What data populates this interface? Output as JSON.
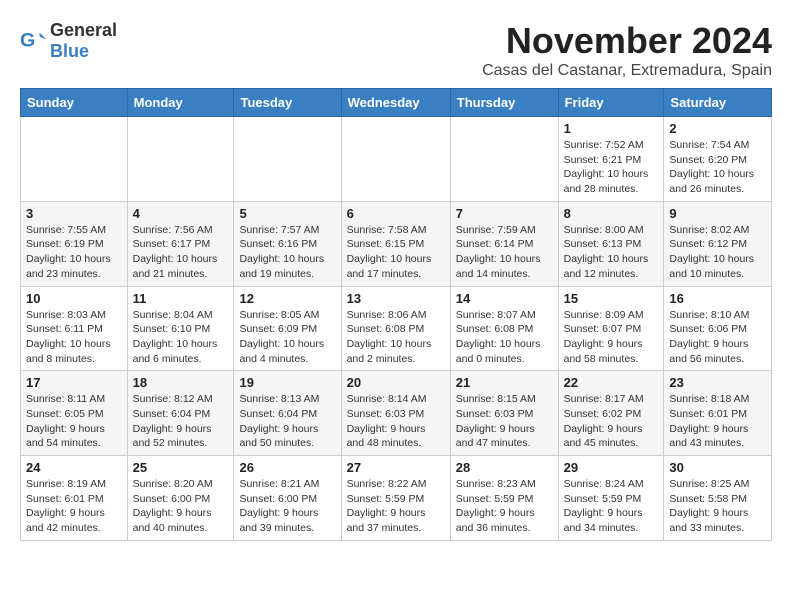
{
  "logo": {
    "general": "General",
    "blue": "Blue"
  },
  "title": "November 2024",
  "subtitle": "Casas del Castanar, Extremadura, Spain",
  "headers": [
    "Sunday",
    "Monday",
    "Tuesday",
    "Wednesday",
    "Thursday",
    "Friday",
    "Saturday"
  ],
  "weeks": [
    [
      {
        "day": "",
        "info": ""
      },
      {
        "day": "",
        "info": ""
      },
      {
        "day": "",
        "info": ""
      },
      {
        "day": "",
        "info": ""
      },
      {
        "day": "",
        "info": ""
      },
      {
        "day": "1",
        "info": "Sunrise: 7:52 AM\nSunset: 6:21 PM\nDaylight: 10 hours and 28 minutes."
      },
      {
        "day": "2",
        "info": "Sunrise: 7:54 AM\nSunset: 6:20 PM\nDaylight: 10 hours and 26 minutes."
      }
    ],
    [
      {
        "day": "3",
        "info": "Sunrise: 7:55 AM\nSunset: 6:19 PM\nDaylight: 10 hours and 23 minutes."
      },
      {
        "day": "4",
        "info": "Sunrise: 7:56 AM\nSunset: 6:17 PM\nDaylight: 10 hours and 21 minutes."
      },
      {
        "day": "5",
        "info": "Sunrise: 7:57 AM\nSunset: 6:16 PM\nDaylight: 10 hours and 19 minutes."
      },
      {
        "day": "6",
        "info": "Sunrise: 7:58 AM\nSunset: 6:15 PM\nDaylight: 10 hours and 17 minutes."
      },
      {
        "day": "7",
        "info": "Sunrise: 7:59 AM\nSunset: 6:14 PM\nDaylight: 10 hours and 14 minutes."
      },
      {
        "day": "8",
        "info": "Sunrise: 8:00 AM\nSunset: 6:13 PM\nDaylight: 10 hours and 12 minutes."
      },
      {
        "day": "9",
        "info": "Sunrise: 8:02 AM\nSunset: 6:12 PM\nDaylight: 10 hours and 10 minutes."
      }
    ],
    [
      {
        "day": "10",
        "info": "Sunrise: 8:03 AM\nSunset: 6:11 PM\nDaylight: 10 hours and 8 minutes."
      },
      {
        "day": "11",
        "info": "Sunrise: 8:04 AM\nSunset: 6:10 PM\nDaylight: 10 hours and 6 minutes."
      },
      {
        "day": "12",
        "info": "Sunrise: 8:05 AM\nSunset: 6:09 PM\nDaylight: 10 hours and 4 minutes."
      },
      {
        "day": "13",
        "info": "Sunrise: 8:06 AM\nSunset: 6:08 PM\nDaylight: 10 hours and 2 minutes."
      },
      {
        "day": "14",
        "info": "Sunrise: 8:07 AM\nSunset: 6:08 PM\nDaylight: 10 hours and 0 minutes."
      },
      {
        "day": "15",
        "info": "Sunrise: 8:09 AM\nSunset: 6:07 PM\nDaylight: 9 hours and 58 minutes."
      },
      {
        "day": "16",
        "info": "Sunrise: 8:10 AM\nSunset: 6:06 PM\nDaylight: 9 hours and 56 minutes."
      }
    ],
    [
      {
        "day": "17",
        "info": "Sunrise: 8:11 AM\nSunset: 6:05 PM\nDaylight: 9 hours and 54 minutes."
      },
      {
        "day": "18",
        "info": "Sunrise: 8:12 AM\nSunset: 6:04 PM\nDaylight: 9 hours and 52 minutes."
      },
      {
        "day": "19",
        "info": "Sunrise: 8:13 AM\nSunset: 6:04 PM\nDaylight: 9 hours and 50 minutes."
      },
      {
        "day": "20",
        "info": "Sunrise: 8:14 AM\nSunset: 6:03 PM\nDaylight: 9 hours and 48 minutes."
      },
      {
        "day": "21",
        "info": "Sunrise: 8:15 AM\nSunset: 6:03 PM\nDaylight: 9 hours and 47 minutes."
      },
      {
        "day": "22",
        "info": "Sunrise: 8:17 AM\nSunset: 6:02 PM\nDaylight: 9 hours and 45 minutes."
      },
      {
        "day": "23",
        "info": "Sunrise: 8:18 AM\nSunset: 6:01 PM\nDaylight: 9 hours and 43 minutes."
      }
    ],
    [
      {
        "day": "24",
        "info": "Sunrise: 8:19 AM\nSunset: 6:01 PM\nDaylight: 9 hours and 42 minutes."
      },
      {
        "day": "25",
        "info": "Sunrise: 8:20 AM\nSunset: 6:00 PM\nDaylight: 9 hours and 40 minutes."
      },
      {
        "day": "26",
        "info": "Sunrise: 8:21 AM\nSunset: 6:00 PM\nDaylight: 9 hours and 39 minutes."
      },
      {
        "day": "27",
        "info": "Sunrise: 8:22 AM\nSunset: 5:59 PM\nDaylight: 9 hours and 37 minutes."
      },
      {
        "day": "28",
        "info": "Sunrise: 8:23 AM\nSunset: 5:59 PM\nDaylight: 9 hours and 36 minutes."
      },
      {
        "day": "29",
        "info": "Sunrise: 8:24 AM\nSunset: 5:59 PM\nDaylight: 9 hours and 34 minutes."
      },
      {
        "day": "30",
        "info": "Sunrise: 8:25 AM\nSunset: 5:58 PM\nDaylight: 9 hours and 33 minutes."
      }
    ]
  ]
}
